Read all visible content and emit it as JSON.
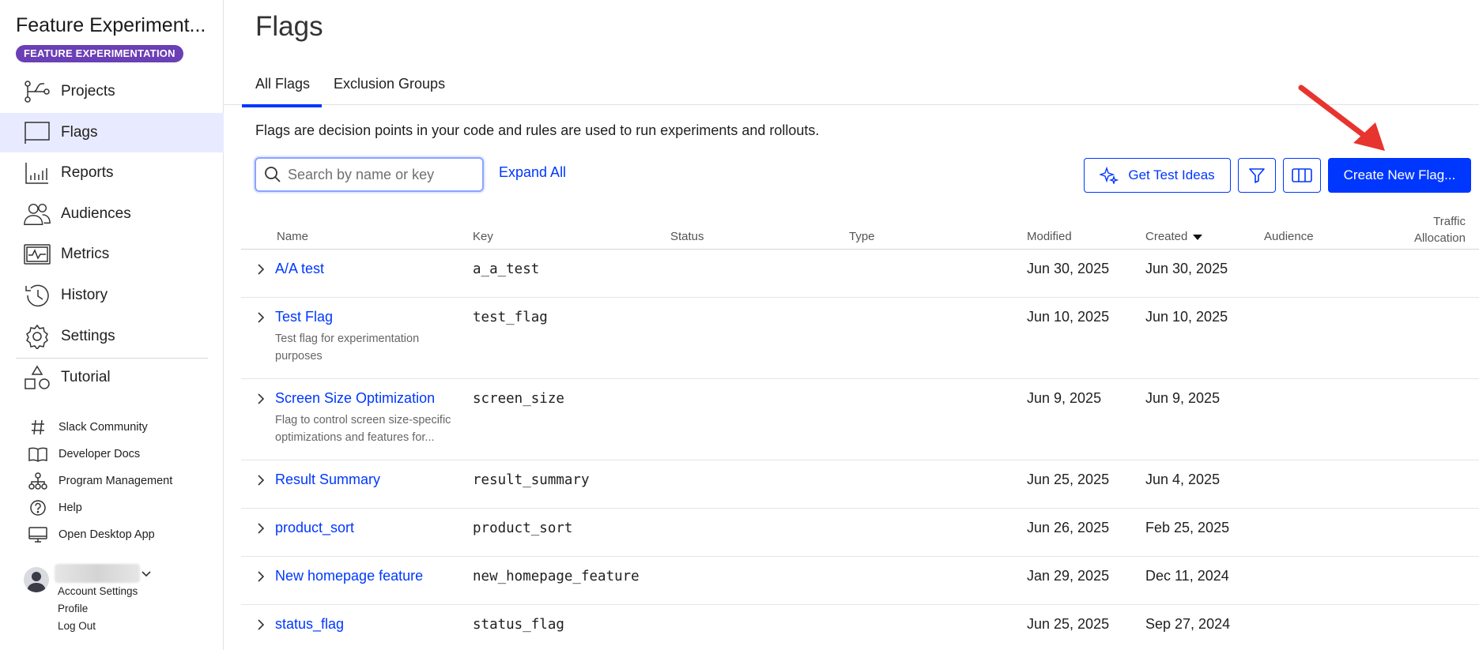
{
  "sidebar": {
    "app_title": "Feature Experiment...",
    "badge": "FEATURE EXPERIMENTATION",
    "nav": [
      {
        "label": "Projects",
        "icon": "projects-icon"
      },
      {
        "label": "Flags",
        "icon": "flag-icon",
        "active": true
      },
      {
        "label": "Reports",
        "icon": "reports-icon"
      },
      {
        "label": "Audiences",
        "icon": "audiences-icon"
      },
      {
        "label": "Metrics",
        "icon": "metrics-icon"
      },
      {
        "label": "History",
        "icon": "history-icon"
      },
      {
        "label": "Settings",
        "icon": "gear-icon"
      },
      {
        "label": "Tutorial",
        "icon": "tutorial-icon"
      }
    ],
    "links": [
      {
        "label": "Slack Community",
        "icon": "hash-icon"
      },
      {
        "label": "Developer Docs",
        "icon": "book-icon"
      },
      {
        "label": "Program Management",
        "icon": "org-chart-icon"
      },
      {
        "label": "Help",
        "icon": "help-icon"
      },
      {
        "label": "Open Desktop App",
        "icon": "monitor-icon"
      }
    ],
    "account": {
      "links": [
        "Account Settings",
        "Profile",
        "Log Out"
      ]
    }
  },
  "page": {
    "title": "Flags",
    "tabs": [
      {
        "label": "All Flags",
        "active": true
      },
      {
        "label": "Exclusion Groups",
        "active": false
      }
    ],
    "description": "Flags are decision points in your code and rules are used to run experiments and rollouts.",
    "search_placeholder": "Search by name or key",
    "expand_all": "Expand All",
    "get_test_ideas": "Get Test Ideas",
    "create_flag": "Create New Flag..."
  },
  "table": {
    "headers": {
      "name": "Name",
      "key": "Key",
      "status": "Status",
      "type": "Type",
      "modified": "Modified",
      "created": "Created",
      "audience": "Audience",
      "traffic_line1": "Traffic",
      "traffic_line2": "Allocation"
    },
    "sort": "Created descending",
    "rows": [
      {
        "name": "A/A test",
        "desc": "",
        "key": "a_a_test",
        "modified": "Jun 30, 2025",
        "created": "Jun 30, 2025"
      },
      {
        "name": "Test Flag",
        "desc": "Test flag for experimentation purposes",
        "key": "test_flag",
        "modified": "Jun 10, 2025",
        "created": "Jun 10, 2025"
      },
      {
        "name": "Screen Size Optimization",
        "desc": "Flag to control screen size-specific optimizations and features for...",
        "key": "screen_size",
        "modified": "Jun 9, 2025",
        "created": "Jun 9, 2025"
      },
      {
        "name": "Result Summary",
        "desc": "",
        "key": "result_summary",
        "modified": "Jun 25, 2025",
        "created": "Jun 4, 2025"
      },
      {
        "name": "product_sort",
        "desc": "",
        "key": "product_sort",
        "modified": "Jun 26, 2025",
        "created": "Feb 25, 2025"
      },
      {
        "name": "New homepage feature",
        "desc": "",
        "key": "new_homepage_feature",
        "modified": "Jan 29, 2025",
        "created": "Dec 11, 2024"
      },
      {
        "name": "status_flag",
        "desc": "",
        "key": "status_flag",
        "modified": "Jun 25, 2025",
        "created": "Sep 27, 2024"
      }
    ]
  },
  "colors": {
    "accent": "#0037ff",
    "badge": "#6b3fb5",
    "active_nav": "#e8ebff",
    "annotation_arrow": "#e8342e"
  }
}
